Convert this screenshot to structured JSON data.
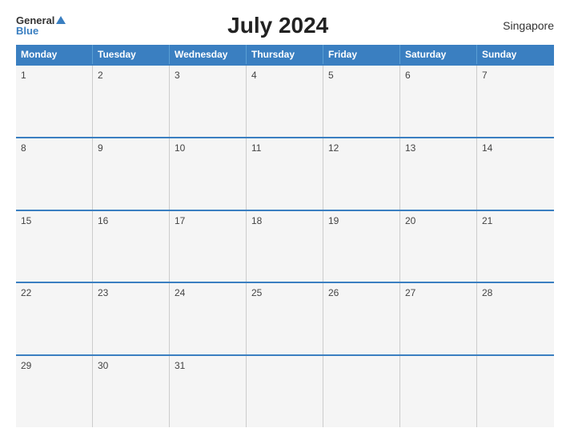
{
  "header": {
    "logo_general": "General",
    "logo_blue": "Blue",
    "title": "July 2024",
    "country": "Singapore"
  },
  "calendar": {
    "weekdays": [
      "Monday",
      "Tuesday",
      "Wednesday",
      "Thursday",
      "Friday",
      "Saturday",
      "Sunday"
    ],
    "weeks": [
      [
        {
          "day": "1",
          "empty": false
        },
        {
          "day": "2",
          "empty": false
        },
        {
          "day": "3",
          "empty": false
        },
        {
          "day": "4",
          "empty": false
        },
        {
          "day": "5",
          "empty": false
        },
        {
          "day": "6",
          "empty": false
        },
        {
          "day": "7",
          "empty": false
        }
      ],
      [
        {
          "day": "8",
          "empty": false
        },
        {
          "day": "9",
          "empty": false
        },
        {
          "day": "10",
          "empty": false
        },
        {
          "day": "11",
          "empty": false
        },
        {
          "day": "12",
          "empty": false
        },
        {
          "day": "13",
          "empty": false
        },
        {
          "day": "14",
          "empty": false
        }
      ],
      [
        {
          "day": "15",
          "empty": false
        },
        {
          "day": "16",
          "empty": false
        },
        {
          "day": "17",
          "empty": false
        },
        {
          "day": "18",
          "empty": false
        },
        {
          "day": "19",
          "empty": false
        },
        {
          "day": "20",
          "empty": false
        },
        {
          "day": "21",
          "empty": false
        }
      ],
      [
        {
          "day": "22",
          "empty": false
        },
        {
          "day": "23",
          "empty": false
        },
        {
          "day": "24",
          "empty": false
        },
        {
          "day": "25",
          "empty": false
        },
        {
          "day": "26",
          "empty": false
        },
        {
          "day": "27",
          "empty": false
        },
        {
          "day": "28",
          "empty": false
        }
      ],
      [
        {
          "day": "29",
          "empty": false
        },
        {
          "day": "30",
          "empty": false
        },
        {
          "day": "31",
          "empty": false
        },
        {
          "day": "",
          "empty": true
        },
        {
          "day": "",
          "empty": true
        },
        {
          "day": "",
          "empty": true
        },
        {
          "day": "",
          "empty": true
        }
      ]
    ]
  }
}
